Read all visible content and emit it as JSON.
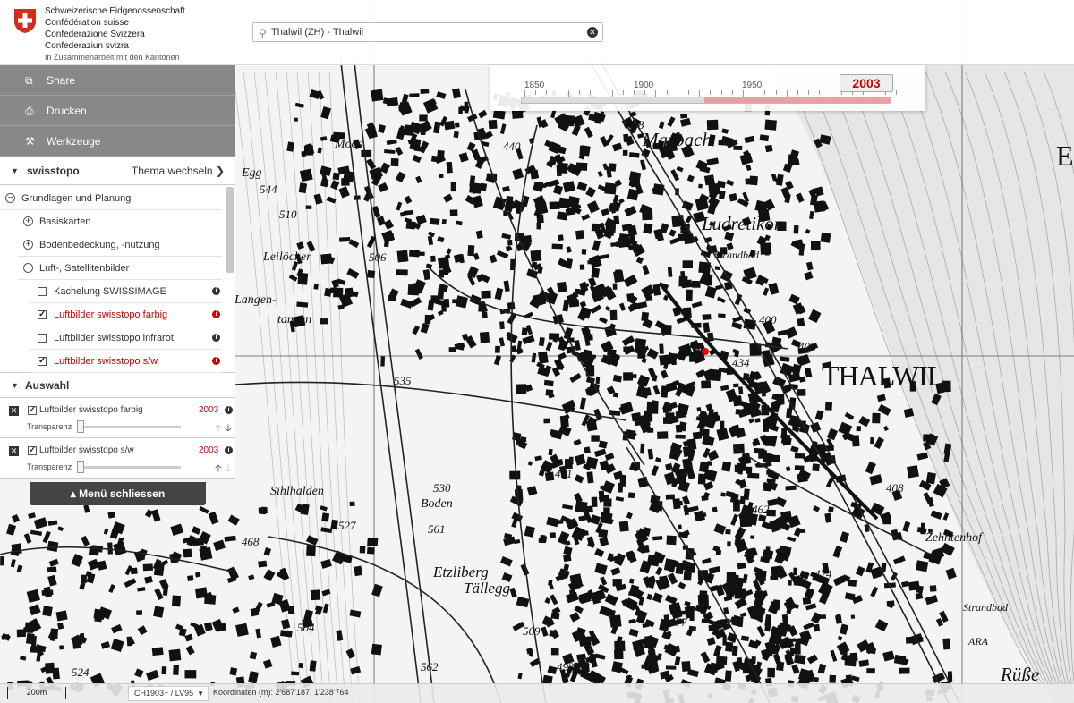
{
  "header": {
    "brand_lines": [
      "Schweizerische Eidgenossenschaft",
      "Confédération suisse",
      "Confederazione Svizzera",
      "Confederaziun svizra"
    ],
    "brand_sub": "In Zusammenarbeit mit den Kantonen",
    "search_value": "Thalwil (ZH) - Thalwil",
    "search_icon": "search-icon",
    "clear_icon": "clear-icon"
  },
  "timeslider": {
    "years": [
      "1850",
      "1900",
      "1950"
    ],
    "selected_year": "2003"
  },
  "tools": [
    {
      "label": "Share",
      "icon": "share-icon"
    },
    {
      "label": "Drucken",
      "icon": "print-icon"
    },
    {
      "label": "Werkzeuge",
      "icon": "tools-icon"
    }
  ],
  "theme": {
    "name": "swisstopo",
    "switch_label": "Thema wechseln"
  },
  "tree": [
    {
      "label": "Grundlagen und Planung",
      "kind": "group",
      "state": "open",
      "level": 0
    },
    {
      "label": "Basiskarten",
      "kind": "group",
      "state": "closed",
      "level": 1
    },
    {
      "label": "Bodenbedeckung, -nutzung",
      "kind": "group",
      "state": "closed",
      "level": 1
    },
    {
      "label": "Luft-, Satellitenbilder",
      "kind": "group",
      "state": "open",
      "level": 1
    },
    {
      "label": "Kachelung SWISSIMAGE",
      "kind": "layer",
      "checked": false,
      "active": false,
      "level": 2
    },
    {
      "label": "Luftbilder swisstopo farbig",
      "kind": "layer",
      "checked": true,
      "active": true,
      "level": 2
    },
    {
      "label": "Luftbilder swisstopo infrarot",
      "kind": "layer",
      "checked": false,
      "active": false,
      "level": 2
    },
    {
      "label": "Luftbilder swisstopo s/w",
      "kind": "layer",
      "checked": true,
      "active": true,
      "level": 2
    }
  ],
  "selection": {
    "title": "Auswahl",
    "items": [
      {
        "label": "Luftbilder swisstopo farbig",
        "year": "2003",
        "transparency_label": "Transparenz",
        "transparency": 0
      },
      {
        "label": "Luftbilder swisstopo s/w",
        "year": "2003",
        "transparency_label": "Transparenz",
        "transparency": 0
      }
    ]
  },
  "close_menu_label": "▴ Menü schliessen",
  "footer": {
    "scale": "200m",
    "projection": "CH1903+ / LV95",
    "coordinates": "Koordinaten (m): 2'687'187, 1'238'764"
  },
  "map": {
    "labels": [
      {
        "text": "THALWIL",
        "cls": "big"
      },
      {
        "text": "Marbach",
        "cls": "l20"
      },
      {
        "text": "Ludretikon",
        "cls": "l20"
      },
      {
        "text": "Strandbad",
        "cls": "l12"
      },
      {
        "text": "Zehntenhof",
        "cls": "l14"
      },
      {
        "text": "Strandbad",
        "cls": "l12"
      },
      {
        "text": "ARA",
        "cls": "l12"
      },
      {
        "text": "Etzliberg",
        "cls": "l17"
      },
      {
        "text": "Tällegg",
        "cls": "l17"
      },
      {
        "text": "Boden",
        "cls": "l14"
      },
      {
        "text": "Sihlhalden",
        "cls": "l14"
      },
      {
        "text": "Leilöcher",
        "cls": "l14"
      },
      {
        "text": "Langen-",
        "cls": "l14"
      },
      {
        "text": "tannen",
        "cls": "l14"
      },
      {
        "text": "Egg",
        "cls": "l14"
      },
      {
        "text": "Moos",
        "cls": "l14"
      },
      {
        "text": "Rüße",
        "cls": "l20"
      },
      {
        "text": "E",
        "cls": "big"
      }
    ],
    "spot_heights": [
      "408",
      "440",
      "409",
      "434",
      "535",
      "530",
      "561",
      "527",
      "468",
      "504",
      "562",
      "569",
      "491",
      "462",
      "474",
      "477",
      "493",
      "544",
      "510",
      "506",
      "408",
      "400",
      "524"
    ]
  }
}
